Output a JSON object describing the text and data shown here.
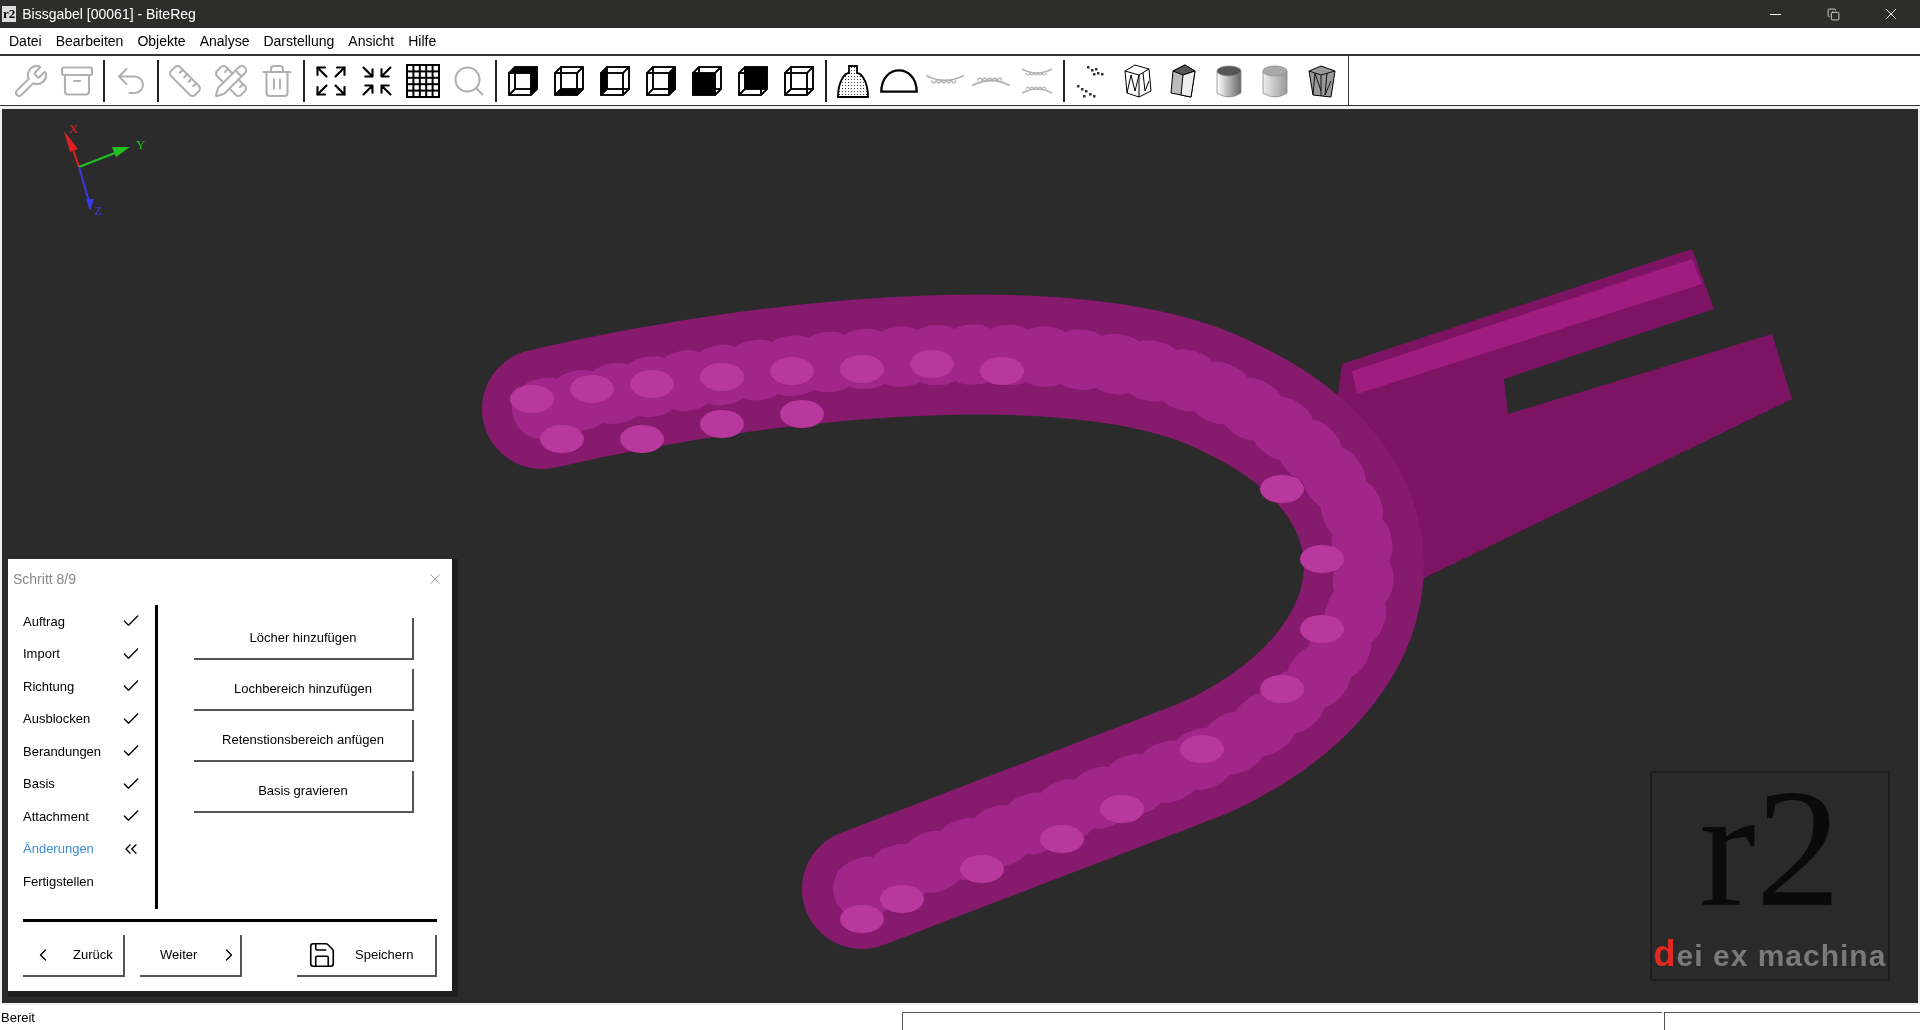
{
  "window": {
    "title": "Bissgabel [00061] - BiteReg",
    "app_icon": "r2"
  },
  "menu": [
    "Datei",
    "Bearbeiten",
    "Objekte",
    "Analyse",
    "Darstellung",
    "Ansicht",
    "Hilfe"
  ],
  "toolbar": [
    [
      {
        "kind": "wrench",
        "disabled": true
      },
      {
        "kind": "archive",
        "disabled": true
      }
    ],
    [
      {
        "kind": "undo",
        "disabled": true
      }
    ],
    [
      {
        "kind": "ruler",
        "disabled": true
      },
      {
        "kind": "ruler-pencil",
        "disabled": true
      },
      {
        "kind": "trash",
        "disabled": true
      }
    ],
    [
      {
        "kind": "expand",
        "disabled": false
      },
      {
        "kind": "shrink",
        "disabled": false
      },
      {
        "kind": "grid",
        "disabled": false
      },
      {
        "kind": "search",
        "disabled": true
      }
    ],
    [
      {
        "kind": "cube-front",
        "disabled": false
      },
      {
        "kind": "cube-bottom",
        "disabled": false
      },
      {
        "kind": "cube-left",
        "disabled": false
      },
      {
        "kind": "cube-right",
        "disabled": false
      },
      {
        "kind": "cube-back",
        "disabled": false
      },
      {
        "kind": "cube-top",
        "disabled": false
      },
      {
        "kind": "cube-plain",
        "disabled": false
      }
    ],
    [
      {
        "kind": "dome",
        "disabled": false
      },
      {
        "kind": "arch",
        "disabled": false
      },
      {
        "kind": "teeth-upper",
        "disabled": true
      },
      {
        "kind": "teeth-lower",
        "disabled": true
      },
      {
        "kind": "teeth-both",
        "disabled": true
      }
    ],
    [
      {
        "kind": "points",
        "disabled": false
      },
      {
        "kind": "wireframe",
        "disabled": false
      },
      {
        "kind": "prism",
        "disabled": false
      },
      {
        "kind": "cylinder",
        "disabled": false
      },
      {
        "kind": "cylinder-soft",
        "disabled": false
      },
      {
        "kind": "prism-wire",
        "disabled": false
      }
    ]
  ],
  "viewport": {
    "axes": [
      {
        "label": "X",
        "color": "#e02020"
      },
      {
        "label": "Y",
        "color": "#20c020"
      },
      {
        "label": "Z",
        "color": "#3a3ae0"
      }
    ],
    "logo": {
      "mark": "r2",
      "tagline_initial": "d",
      "tagline_rest": "ei ex machina"
    }
  },
  "wizard": {
    "title": "Schritt 8/9",
    "steps": [
      {
        "label": "Auftrag",
        "done": true,
        "selected": false
      },
      {
        "label": "Import",
        "done": true,
        "selected": false
      },
      {
        "label": "Richtung",
        "done": true,
        "selected": false
      },
      {
        "label": "Ausblocken",
        "done": true,
        "selected": false
      },
      {
        "label": "Berandungen",
        "done": true,
        "selected": false
      },
      {
        "label": "Basis",
        "done": true,
        "selected": false
      },
      {
        "label": "Attachment",
        "done": true,
        "selected": false
      },
      {
        "label": "Änderungen",
        "done": false,
        "selected": true
      },
      {
        "label": "Fertigstellen",
        "done": false,
        "selected": false
      }
    ],
    "actions": [
      "Löcher hinzufügen",
      "Lochbereich hinzufügen",
      "Retenstionsbereich anfügen",
      "Basis gravieren"
    ],
    "back": "Zurück",
    "next": "Weiter",
    "save": "Speichern"
  },
  "status_bar": {
    "text": "Bereit"
  }
}
